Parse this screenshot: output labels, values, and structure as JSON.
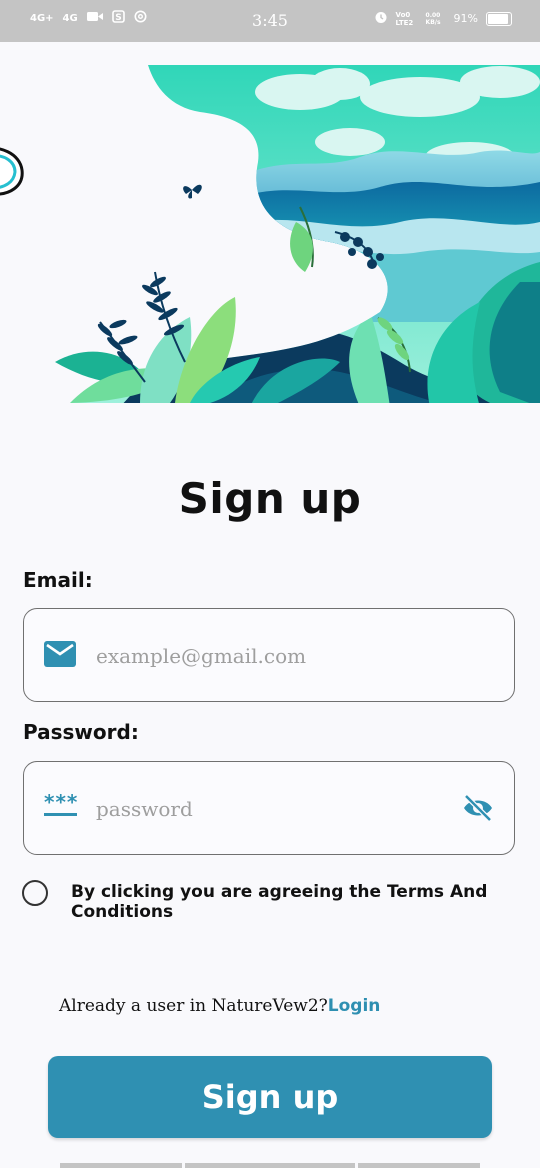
{
  "status_bar": {
    "network1": "4G+",
    "network2": "4G",
    "time": "3:45",
    "volte": "Vo0 LTE2",
    "speed": "0.00 KB/s",
    "battery": "91%"
  },
  "page": {
    "title": "Sign up"
  },
  "email": {
    "label": "Email:",
    "placeholder": "example@gmail.com",
    "value": ""
  },
  "password": {
    "label": "Password:",
    "mask_glyph": "***",
    "placeholder": "password",
    "value": ""
  },
  "terms": {
    "text": "By clicking you are agreeing the Terms And Conditions",
    "checked": false
  },
  "login_prompt": {
    "text": "Already a user in NatureVew2?",
    "link": "Login"
  },
  "signup_button": {
    "label": "Sign up"
  },
  "colors": {
    "accent": "#2f90b2",
    "teal": "#25c9b0",
    "deep_blue": "#0b3a5e"
  }
}
